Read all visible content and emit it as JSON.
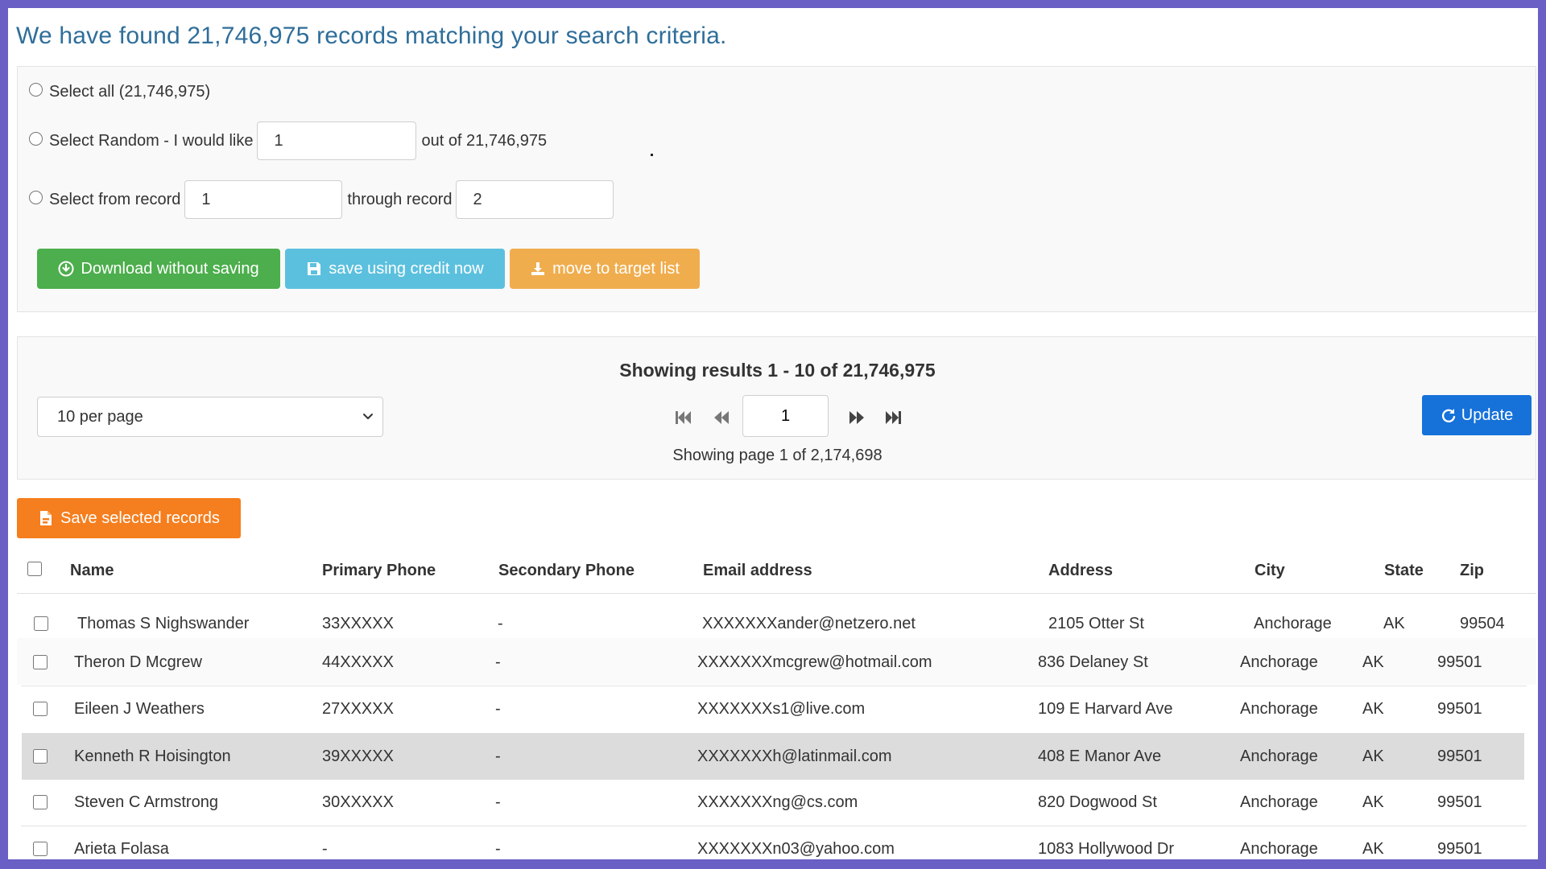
{
  "headline": "We have found 21,746,975 records matching your search criteria.",
  "selection": {
    "select_all_label": "Select all (21,746,975)",
    "random_prefix": "Select Random - I would like",
    "random_value": "1",
    "random_suffix": "out of 21,746,975",
    "from_label": "Select from record",
    "from_value": "1",
    "through_label": "through record",
    "through_value": "2"
  },
  "actions": {
    "download_label": "Download without saving",
    "save_credit_label": "save using credit now",
    "move_target_label": "move to target list"
  },
  "pager": {
    "showing_title": "Showing results 1 - 10 of 21,746,975",
    "per_page": "10 per page",
    "current_page": "1",
    "page_info": "Showing page 1 of 2,174,698",
    "update_label": "Update"
  },
  "save_selected_label": "Save selected records",
  "table": {
    "headers": [
      "Name",
      "Primary Phone",
      "Secondary Phone",
      "Email address",
      "Address",
      "City",
      "State",
      "Zip"
    ],
    "rows": [
      [
        "Thomas S Nighswander",
        "33XXXXX",
        "-",
        "XXXXXXXander@netzero.net",
        "2105 Otter St",
        "Anchorage",
        "AK",
        "99504"
      ],
      [
        "Theron D Mcgrew",
        "44XXXXX",
        "-",
        "XXXXXXXmcgrew@hotmail.com",
        "836 Delaney St",
        "Anchorage",
        "AK",
        "99501"
      ],
      [
        "Eileen J Weathers",
        "27XXXXX",
        "-",
        "XXXXXXXs1@live.com",
        "109 E Harvard Ave",
        "Anchorage",
        "AK",
        "99501"
      ],
      [
        "Kenneth R Hoisington",
        "39XXXXX",
        "-",
        "XXXXXXXh@latinmail.com",
        "408 E Manor Ave",
        "Anchorage",
        "AK",
        "99501"
      ],
      [
        "Steven C Armstrong",
        "30XXXXX",
        "-",
        "XXXXXXXng@cs.com",
        "820 Dogwood St",
        "Anchorage",
        "AK",
        "99501"
      ],
      [
        "Arieta Folasa",
        "-",
        "-",
        "XXXXXXXn03@yahoo.com",
        "1083 Hollywood Dr",
        "Anchorage",
        "AK",
        "99501"
      ]
    ]
  },
  "colors": {
    "frame": "#6a5fc4",
    "headline": "#2f6e9a",
    "download": "#4cae4c",
    "save_credit": "#5bc0de",
    "move_target": "#f0ad4e",
    "update": "#1671d9",
    "save_selected": "#f57e1e"
  }
}
